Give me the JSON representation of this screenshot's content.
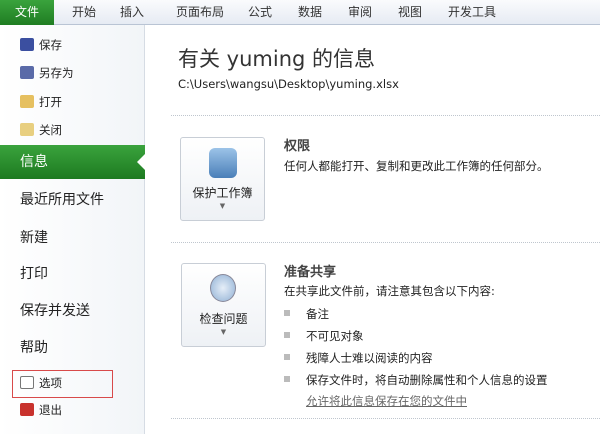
{
  "tabs": [
    "文件",
    "开始",
    "插入",
    "页面布局",
    "公式",
    "数据",
    "审阅",
    "视图",
    "开发工具"
  ],
  "sidebar": {
    "save": "保存",
    "save_as": "另存为",
    "open": "打开",
    "close": "关闭",
    "info": "信息",
    "recent": "最近所用文件",
    "new": "新建",
    "print": "打印",
    "save_send": "保存并发送",
    "help": "帮助",
    "options": "选项",
    "exit": "退出"
  },
  "main": {
    "title": "有关 yuming 的信息",
    "path": "C:\\Users\\wangsu\\Desktop\\yuming.xlsx",
    "permissions": {
      "button": "保护工作簿",
      "heading": "权限",
      "desc": "任何人都能打开、复制和更改此工作簿的任何部分。"
    },
    "prepare": {
      "button": "检查问题",
      "heading": "准备共享",
      "desc": "在共享此文件前，请注意其包含以下内容:",
      "items": [
        "备注",
        "不可见对象",
        "残障人士难以阅读的内容",
        "保存文件时，将自动删除属性和个人信息的设置"
      ],
      "link": "允许将此信息保存在您的文件中"
    }
  }
}
